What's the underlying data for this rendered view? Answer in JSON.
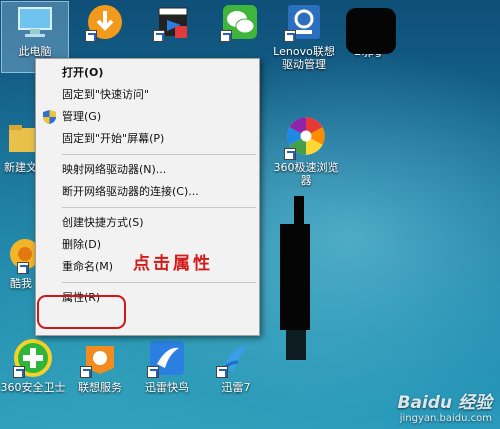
{
  "desktop": {
    "icons": [
      {
        "label": "此电脑",
        "icon": "computer-icon"
      },
      {
        "label": "",
        "icon": "download-app-icon"
      },
      {
        "label": "",
        "icon": "media-app-icon"
      },
      {
        "label": "",
        "icon": "wechat-icon"
      },
      {
        "label": "Lenovo联想\n驱动管理",
        "icon": "lenovo-driver-icon"
      },
      {
        "label": "2.jpg",
        "icon": "image-file-icon"
      },
      {
        "label": "新建文",
        "icon": "folder-icon"
      },
      {
        "label": "360极速浏览\n器",
        "icon": "360-browser-icon"
      },
      {
        "label": "酷我",
        "icon": "kuwo-icon"
      },
      {
        "label": "360安全卫士",
        "icon": "360-security-icon"
      },
      {
        "label": "联想服务",
        "icon": "lenovo-service-icon"
      },
      {
        "label": "迅雷快鸟",
        "icon": "xunlei-kuainiao-icon"
      },
      {
        "label": "迅雷7",
        "icon": "xunlei7-icon"
      }
    ]
  },
  "context_menu": {
    "items": [
      {
        "label": "打开(O)",
        "bold": true
      },
      {
        "label": "固定到\"快速访问\""
      },
      {
        "label": "管理(G)",
        "icon": "uac-shield-icon"
      },
      {
        "label": "固定到\"开始\"屏幕(P)"
      },
      {
        "label": "映射网络驱动器(N)..."
      },
      {
        "label": "断开网络驱动器的连接(C)..."
      },
      {
        "label": "创建快捷方式(S)"
      },
      {
        "label": "删除(D)"
      },
      {
        "label": "重命名(M)"
      },
      {
        "label": "属性(R)"
      }
    ]
  },
  "annotation": {
    "text": "点击属性",
    "color": "#d41a1a"
  },
  "watermark": {
    "main": "Baidu 经验",
    "url": "jingyan.baidu.com"
  },
  "colors": {
    "menu_bg": "#f2f2f2",
    "highlight": "#d01818"
  }
}
